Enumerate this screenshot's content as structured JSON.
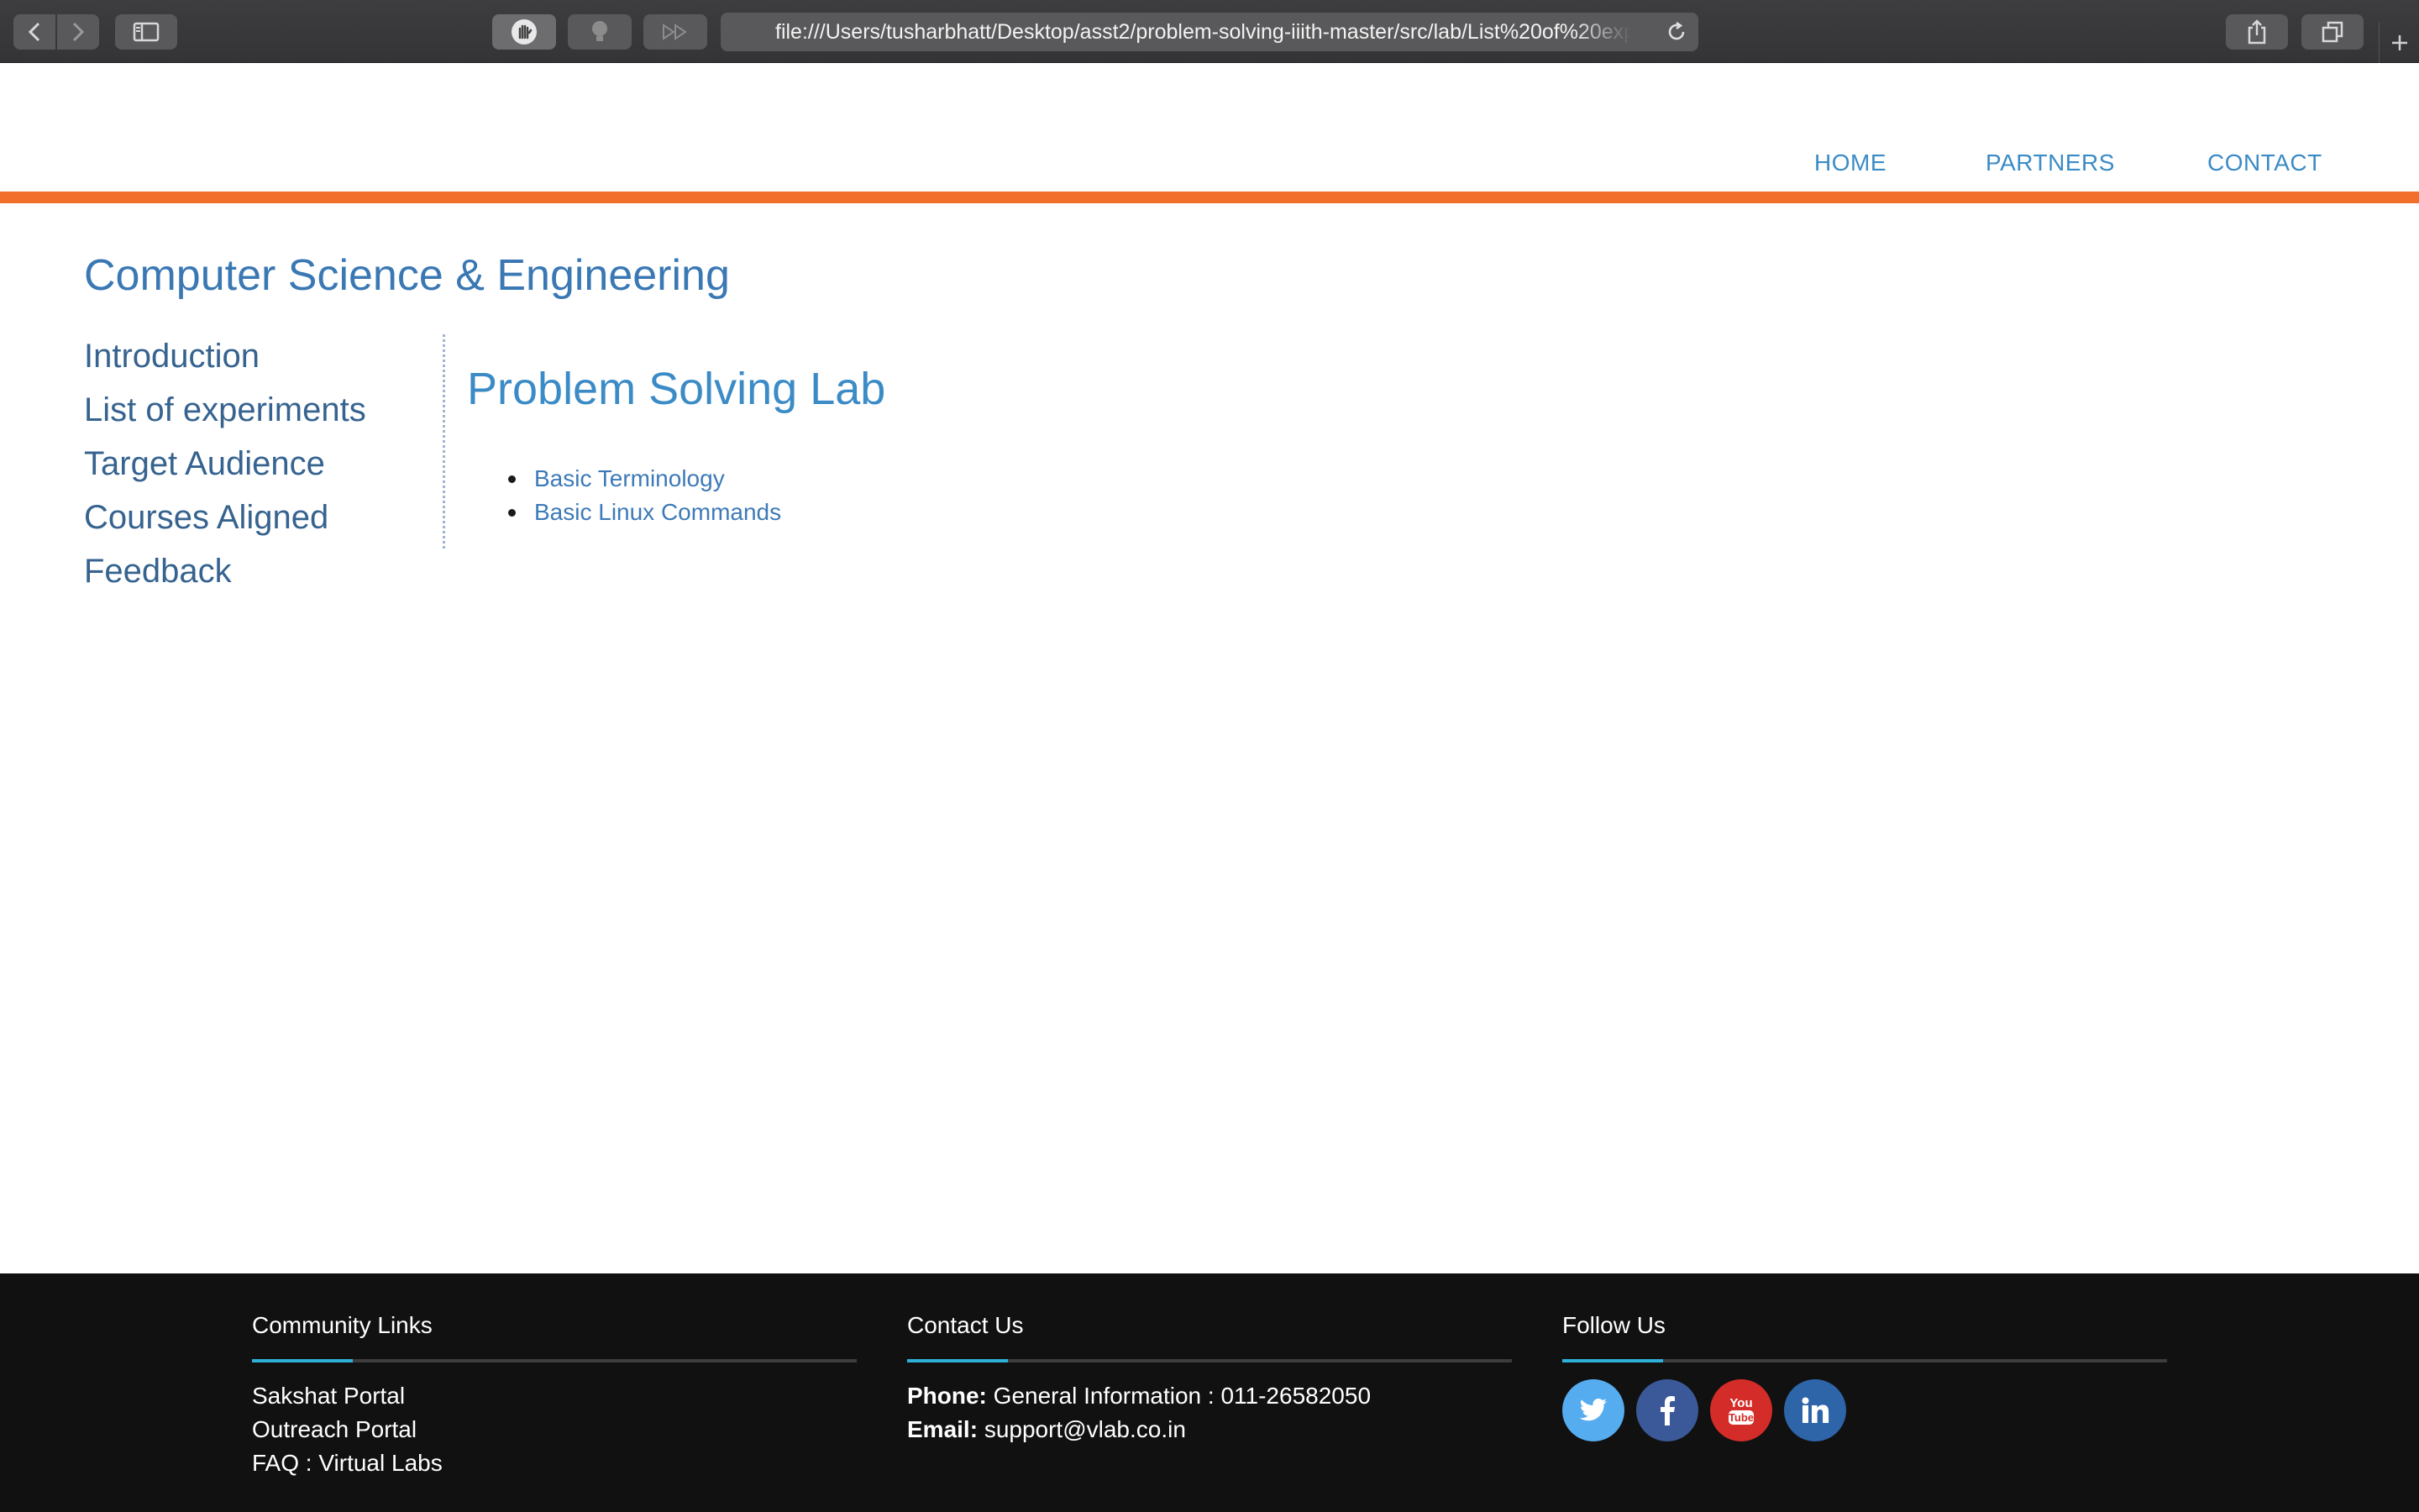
{
  "browser": {
    "url": "file:///Users/tusharbhatt/Desktop/asst2/problem-solving-iiith-master/src/lab/List%20of%20experiments.html"
  },
  "nav": {
    "home": "HOME",
    "partners": "PARTNERS",
    "contact": "CONTACT"
  },
  "department": "Computer Science & Engineering",
  "sidebar": {
    "items": [
      {
        "label": "Introduction"
      },
      {
        "label": "List of experiments"
      },
      {
        "label": "Target Audience"
      },
      {
        "label": "Courses Aligned"
      },
      {
        "label": "Feedback"
      }
    ]
  },
  "main": {
    "title": "Problem Solving Lab",
    "experiments": [
      {
        "label": "Basic Terminology"
      },
      {
        "label": "Basic Linux Commands"
      }
    ]
  },
  "footer": {
    "community": {
      "heading": "Community Links",
      "links": [
        "Sakshat Portal",
        "Outreach Portal",
        "FAQ : Virtual Labs"
      ]
    },
    "contact": {
      "heading": "Contact Us",
      "phone_label": "Phone:",
      "phone_value": "General Information : 011-26582050",
      "email_label": "Email:",
      "email_value": "support@vlab.co.in"
    },
    "follow": {
      "heading": "Follow Us",
      "icons": [
        "twitter-icon",
        "facebook-icon",
        "youtube-icon",
        "linkedin-icon"
      ]
    }
  },
  "colors": {
    "accent_orange": "#f26f2b",
    "link_blue": "#3b8bc6",
    "footer_bg": "#111111",
    "footer_accent": "#2fb0d8",
    "twitter": "#55acee",
    "facebook": "#3b5998",
    "youtube": "#d42c28",
    "linkedin": "#2e64a8"
  }
}
